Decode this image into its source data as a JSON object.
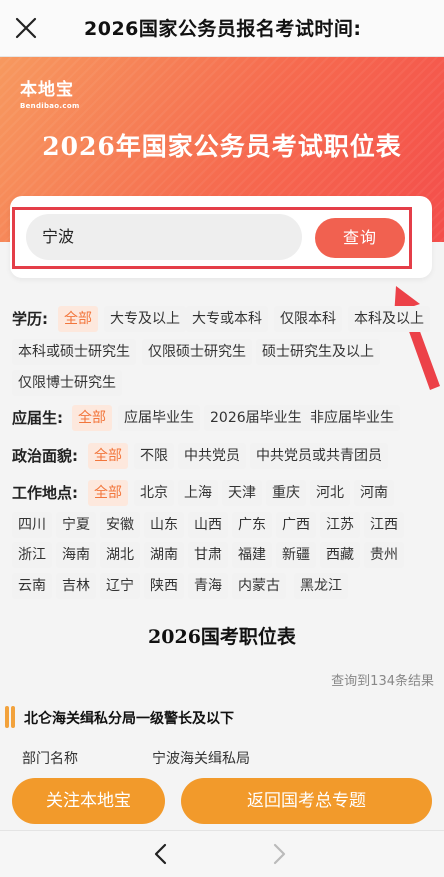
{
  "topbar": {
    "title": "2026国家公务员报名考试时间:"
  },
  "banner": {
    "logo_zh": "本地宝",
    "logo_en": "Bendibao.com",
    "title": "2026年国家公务员考试职位表"
  },
  "search": {
    "value": "宁波",
    "button_label": "查询"
  },
  "filters": {
    "education": {
      "label": "学历:",
      "options": [
        "全部",
        "大专及以上",
        "大专或本科",
        "仅限本科",
        "本科及以上",
        "本科或硕士研究生",
        "仅限硕士研究生",
        "硕士研究生及以上",
        "仅限博士研究生"
      ],
      "selected": "全部"
    },
    "graduate": {
      "label": "应届生:",
      "options": [
        "全部",
        "应届毕业生",
        "2026届毕业生",
        "非应届毕业生"
      ],
      "selected": "全部"
    },
    "political": {
      "label": "政治面貌:",
      "options": [
        "全部",
        "不限",
        "中共党员",
        "中共党员或共青团员"
      ],
      "selected": "全部"
    },
    "location": {
      "label": "工作地点:",
      "options": [
        "全部",
        "北京",
        "上海",
        "天津",
        "重庆",
        "河北",
        "河南",
        "四川",
        "宁夏",
        "安徽",
        "山东",
        "山西",
        "广东",
        "广西",
        "江苏",
        "江西",
        "浙江",
        "海南",
        "湖北",
        "湖南",
        "甘肃",
        "福建",
        "新疆",
        "西藏",
        "贵州",
        "云南",
        "吉林",
        "辽宁",
        "陕西",
        "青海",
        "内蒙古",
        "黑龙江"
      ],
      "selected": "全部"
    }
  },
  "results": {
    "title": "2026国考职位表",
    "count_text": "查询到134条结果",
    "first_job": {
      "title": "北仑海关缉私分局一级警长及以下",
      "dept_label": "部门名称",
      "dept_value": "宁波海关缉私局"
    }
  },
  "actions": {
    "follow_label": "关注本地宝",
    "back_label": "返回国考总专题"
  },
  "colors": {
    "accent": "#f16150",
    "orange": "#f29a2b",
    "highlight_frame": "#e43e48",
    "active_chip_text": "#f2763c"
  }
}
